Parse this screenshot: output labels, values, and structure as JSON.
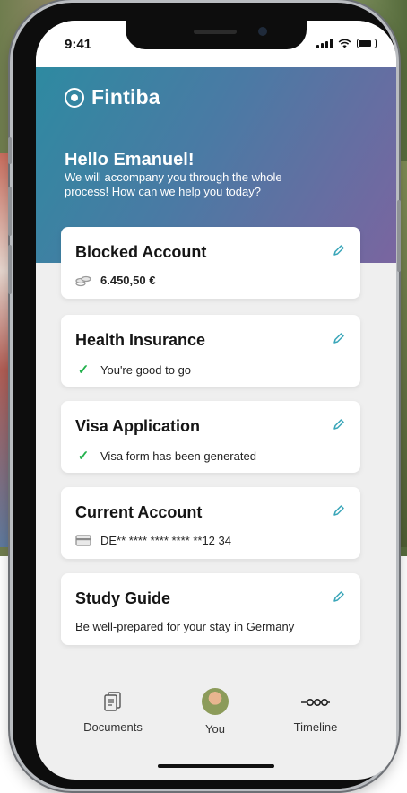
{
  "status_bar": {
    "time": "9:41"
  },
  "app": {
    "brand": "Fintiba"
  },
  "hero": {
    "greeting": "Hello Emanuel!",
    "subtitle": "We will accompany you through the whole process! How can we help you today?"
  },
  "cards": [
    {
      "title": "Blocked Account",
      "detail": "6.450,50 €",
      "icon": "coins-icon"
    },
    {
      "title": "Health Insurance",
      "detail": "You're good to go",
      "icon": "checkmark-icon"
    },
    {
      "title": "Visa Application",
      "detail": "Visa form has been generated",
      "icon": "checkmark-icon"
    },
    {
      "title": "Current Account",
      "detail": "DE** **** **** **** **12 34",
      "icon": "credit-card-icon"
    },
    {
      "title": "Study Guide",
      "detail": "Be well-prepared for your stay in Germany",
      "icon": ""
    }
  ],
  "tabs": [
    {
      "label": "Documents",
      "icon": "documents-icon"
    },
    {
      "label": "You",
      "icon": "avatar"
    },
    {
      "label": "Timeline",
      "icon": "timeline-icon"
    }
  ],
  "colors": {
    "hero_start": "#2e8aa1",
    "hero_end": "#7a65a0",
    "accent": "#3aa6b9",
    "check": "#22b14c"
  }
}
